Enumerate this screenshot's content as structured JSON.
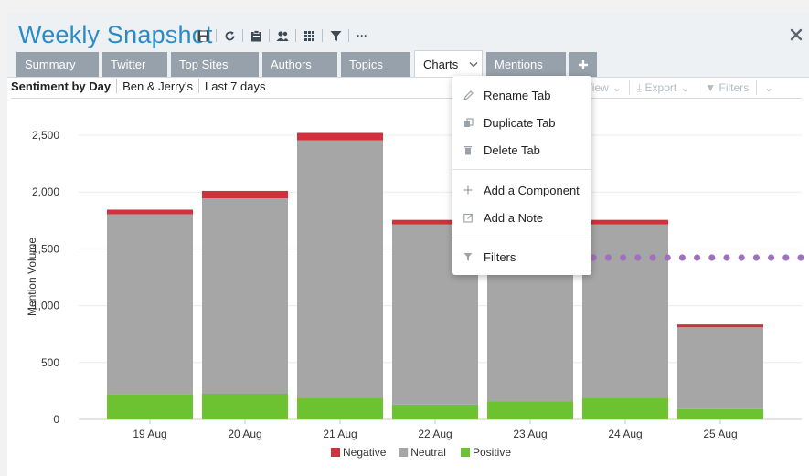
{
  "header": {
    "title": "Weekly Snapshot",
    "toolbar_icons": [
      "save-icon",
      "refresh-icon",
      "clipboard-icon",
      "users-icon",
      "grid-icon",
      "filter-icon",
      "more-icon"
    ],
    "more_label": "···"
  },
  "close_glyph": "×",
  "tabs": [
    {
      "label": "Summary"
    },
    {
      "label": "Twitter"
    },
    {
      "label": "Top Sites"
    },
    {
      "label": "Authors"
    },
    {
      "label": "Topics"
    },
    {
      "label": "Charts",
      "active": true
    },
    {
      "label": "Mentions"
    }
  ],
  "add_tab_glyph": "+",
  "component": {
    "title": "Sentiment by Day",
    "brand": "Ben & Jerry's",
    "range": "Last 7 days",
    "right_tools": {
      "view": "View",
      "export": "Export",
      "filters": "Filters"
    }
  },
  "menu": {
    "items": [
      {
        "label": "Rename Tab",
        "icon": "pencil-icon"
      },
      {
        "label": "Duplicate Tab",
        "icon": "duplicate-icon"
      },
      {
        "label": "Delete Tab",
        "icon": "trash-icon"
      },
      {
        "label": "Add a Component",
        "icon": "plus-icon"
      },
      {
        "label": "Add a Note",
        "icon": "note-icon"
      },
      {
        "label": "Filters",
        "icon": "filter-icon"
      }
    ]
  },
  "colors": {
    "title": "#2a8bc8",
    "tab_bg": "#97a1ab",
    "negative": "#d0313b",
    "neutral": "#a6a6a6",
    "positive": "#6cc230",
    "dots": "#a070c0"
  },
  "chart_data": {
    "type": "bar",
    "stacked": true,
    "title": "",
    "xlabel": "",
    "ylabel": "Mention Volume",
    "ylim": [
      0,
      2500
    ],
    "yticks": [
      0,
      500,
      1000,
      1500,
      2000,
      2500
    ],
    "ytick_labels": [
      "0",
      "500",
      "1,000",
      "1,500",
      "2,000",
      "2,500"
    ],
    "grid": true,
    "legend": "bottom",
    "categories": [
      "19 Aug",
      "20 Aug",
      "21 Aug",
      "22 Aug",
      "23 Aug",
      "24 Aug",
      "25 Aug"
    ],
    "series": [
      {
        "name": "Positive",
        "values": [
          220,
          225,
          185,
          130,
          160,
          185,
          90
        ]
      },
      {
        "name": "Neutral",
        "values": [
          1585,
          1720,
          2270,
          1585,
          1270,
          1530,
          720
        ]
      },
      {
        "name": "Negative",
        "values": [
          40,
          65,
          65,
          40,
          45,
          40,
          25
        ]
      }
    ],
    "legend_order": [
      "Negative",
      "Neutral",
      "Positive"
    ]
  }
}
